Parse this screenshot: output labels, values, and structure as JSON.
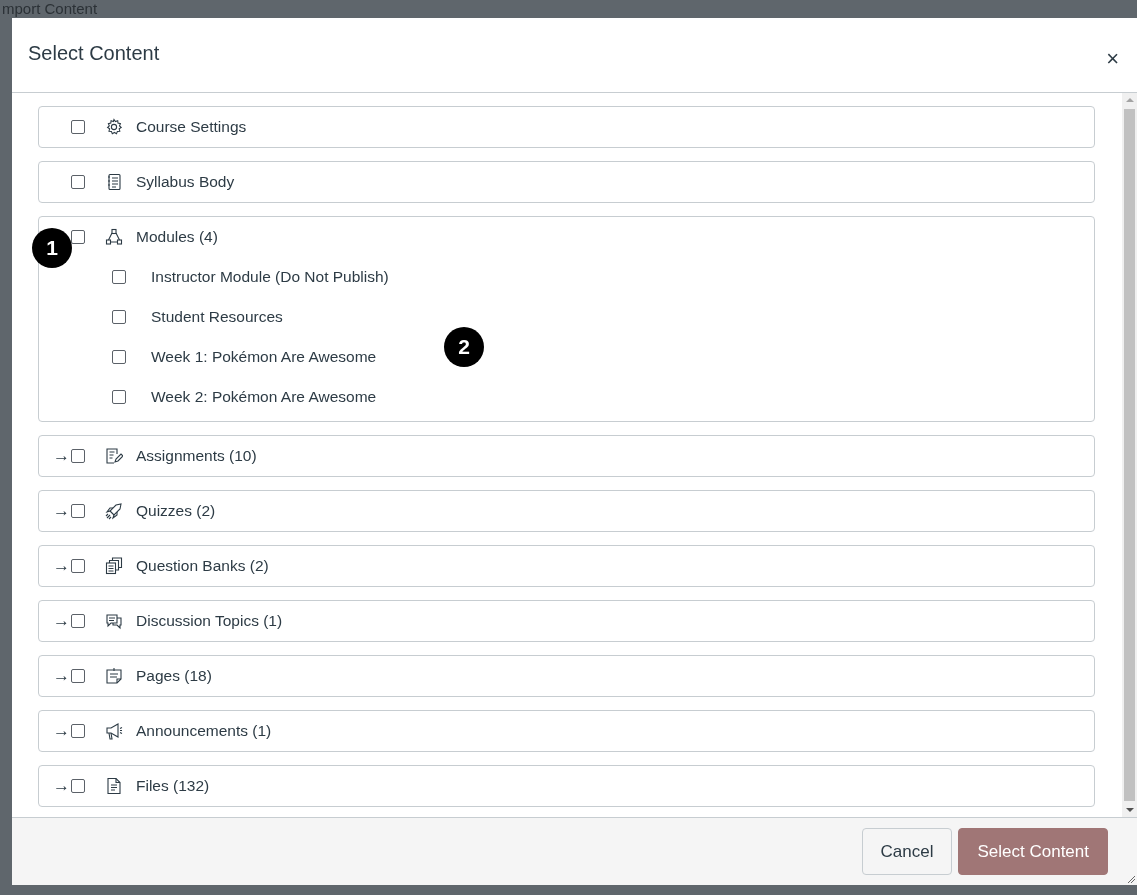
{
  "background": {
    "heading": "mport Content"
  },
  "dialog": {
    "title": "Select Content",
    "close": "×",
    "items": [
      {
        "kind": "settings",
        "label": "Course Settings",
        "checked": false
      },
      {
        "kind": "syllabus",
        "label": "Syllabus Body",
        "checked": false
      },
      {
        "kind": "modules",
        "label": "Modules (4)",
        "checked": false,
        "children": [
          {
            "label": "Instructor Module (Do Not Publish)",
            "checked": false
          },
          {
            "label": "Student Resources",
            "checked": false
          },
          {
            "label": "Week 1: Pokémon Are Awesome",
            "checked": false
          },
          {
            "label": "Week 2: Pokémon Are Awesome",
            "checked": false
          }
        ]
      },
      {
        "kind": "assignments",
        "arrow": "→",
        "label": "Assignments (10)",
        "checked": false
      },
      {
        "kind": "quizzes",
        "arrow": "→",
        "label": "Quizzes (2)",
        "checked": false
      },
      {
        "kind": "banks",
        "arrow": "→",
        "label": "Question Banks (2)",
        "checked": false
      },
      {
        "kind": "discussions",
        "arrow": "→",
        "label": "Discussion Topics (1)",
        "checked": false
      },
      {
        "kind": "pages",
        "arrow": "→",
        "label": "Pages (18)",
        "checked": false
      },
      {
        "kind": "announcements",
        "arrow": "→",
        "label": "Announcements (1)",
        "checked": false
      },
      {
        "kind": "files",
        "arrow": "→",
        "label": "Files (132)",
        "checked": false
      }
    ],
    "buttons": [
      {
        "kind": "secondary",
        "label": "Cancel"
      },
      {
        "kind": "primary",
        "label": "Select Content"
      }
    ]
  },
  "annotations": [
    {
      "label": "1"
    },
    {
      "label": "2"
    }
  ]
}
